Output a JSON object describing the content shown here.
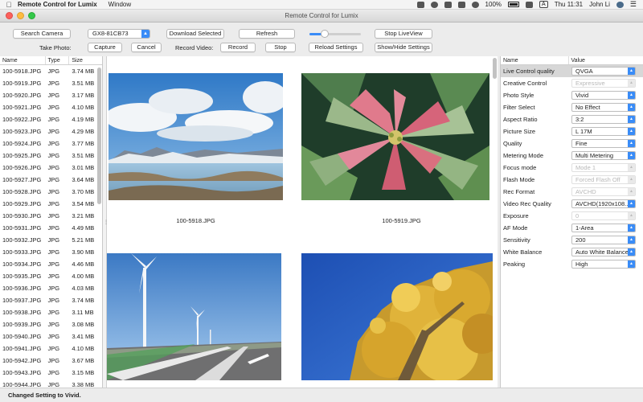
{
  "menubar": {
    "app_name": "Remote Control for Lumix",
    "menus": [
      "Window"
    ],
    "battery": "100%",
    "clock": "Thu 11:31",
    "user": "John Li",
    "input_source": "A"
  },
  "window": {
    "title": "Remote Control for Lumix"
  },
  "toolbar": {
    "search_camera": "Search Camera",
    "camera_select": "GX8-81CB73",
    "download_selected": "Download Selected",
    "refresh": "Refresh",
    "zoom_level": 0.3,
    "stop_liveview": "Stop LiveView",
    "take_photo_label": "Take Photo:",
    "capture": "Capture",
    "cancel": "Cancel",
    "record_video_label": "Record Video:",
    "record": "Record",
    "stop": "Stop",
    "reload_settings": "Reload Settings",
    "show_hide_settings": "Show/Hide Settings"
  },
  "files": {
    "columns": [
      "Name",
      "Type",
      "Size"
    ],
    "rows": [
      [
        "100-5918.JPG",
        "JPG",
        "3.74 MB"
      ],
      [
        "100-5919.JPG",
        "JPG",
        "3.51 MB"
      ],
      [
        "100-5920.JPG",
        "JPG",
        "3.17 MB"
      ],
      [
        "100-5921.JPG",
        "JPG",
        "4.10 MB"
      ],
      [
        "100-5922.JPG",
        "JPG",
        "4.19 MB"
      ],
      [
        "100-5923.JPG",
        "JPG",
        "4.29 MB"
      ],
      [
        "100-5924.JPG",
        "JPG",
        "3.77 MB"
      ],
      [
        "100-5925.JPG",
        "JPG",
        "3.51 MB"
      ],
      [
        "100-5926.JPG",
        "JPG",
        "3.01 MB"
      ],
      [
        "100-5927.JPG",
        "JPG",
        "3.64 MB"
      ],
      [
        "100-5928.JPG",
        "JPG",
        "3.70 MB"
      ],
      [
        "100-5929.JPG",
        "JPG",
        "3.54 MB"
      ],
      [
        "100-5930.JPG",
        "JPG",
        "3.21 MB"
      ],
      [
        "100-5931.JPG",
        "JPG",
        "4.49 MB"
      ],
      [
        "100-5932.JPG",
        "JPG",
        "5.21 MB"
      ],
      [
        "100-5933.JPG",
        "JPG",
        "3.90 MB"
      ],
      [
        "100-5934.JPG",
        "JPG",
        "4.46 MB"
      ],
      [
        "100-5935.JPG",
        "JPG",
        "4.00 MB"
      ],
      [
        "100-5936.JPG",
        "JPG",
        "4.03 MB"
      ],
      [
        "100-5937.JPG",
        "JPG",
        "3.74 MB"
      ],
      [
        "100-5938.JPG",
        "JPG",
        "3.11 MB"
      ],
      [
        "100-5939.JPG",
        "JPG",
        "3.08 MB"
      ],
      [
        "100-5940.JPG",
        "JPG",
        "3.41 MB"
      ],
      [
        "100-5941.JPG",
        "JPG",
        "4.10 MB"
      ],
      [
        "100-5942.JPG",
        "JPG",
        "3.67 MB"
      ],
      [
        "100-5943.JPG",
        "JPG",
        "3.15 MB"
      ],
      [
        "100-5944.JPG",
        "JPG",
        "3.38 MB"
      ]
    ]
  },
  "thumbnails": [
    {
      "caption": "100-5918.JPG",
      "scene": "lake-landscape"
    },
    {
      "caption": "100-5919.JPG",
      "scene": "poinsettia-leaves"
    },
    {
      "caption": "",
      "scene": "wind-turbines-highway"
    },
    {
      "caption": "",
      "scene": "autumn-tree"
    }
  ],
  "settings": {
    "columns": [
      "Name",
      "Value"
    ],
    "rows": [
      {
        "name": "Live Control quality",
        "value": "QVGA",
        "enabled": true
      },
      {
        "name": "Creative Control",
        "value": "Expressive",
        "enabled": false
      },
      {
        "name": "Photo Style",
        "value": "Vivid",
        "enabled": true
      },
      {
        "name": "Filter Select",
        "value": "No Effect",
        "enabled": true
      },
      {
        "name": "Aspect Ratio",
        "value": "3:2",
        "enabled": true
      },
      {
        "name": "Picture Size",
        "value": "L 17M",
        "enabled": true
      },
      {
        "name": "Quality",
        "value": "Fine",
        "enabled": true
      },
      {
        "name": "Metering Mode",
        "value": "Multi Metering",
        "enabled": true
      },
      {
        "name": "Focus mode",
        "value": "Mode 1",
        "enabled": false
      },
      {
        "name": "Flash Mode",
        "value": "Forced Flash Off",
        "enabled": false
      },
      {
        "name": "Rec Format",
        "value": "AVCHD",
        "enabled": false
      },
      {
        "name": "Video Rec Quality",
        "value": "AVCHD(1920x108...",
        "enabled": true
      },
      {
        "name": "Exposure",
        "value": "0",
        "enabled": false
      },
      {
        "name": "AF Mode",
        "value": "1-Area",
        "enabled": true
      },
      {
        "name": "Sensitivity",
        "value": "200",
        "enabled": true
      },
      {
        "name": "White Balance",
        "value": "Auto White Balance",
        "enabled": true
      },
      {
        "name": "Peaking",
        "value": "High",
        "enabled": true
      }
    ]
  },
  "status_text": "Changed Setting to Vivid."
}
